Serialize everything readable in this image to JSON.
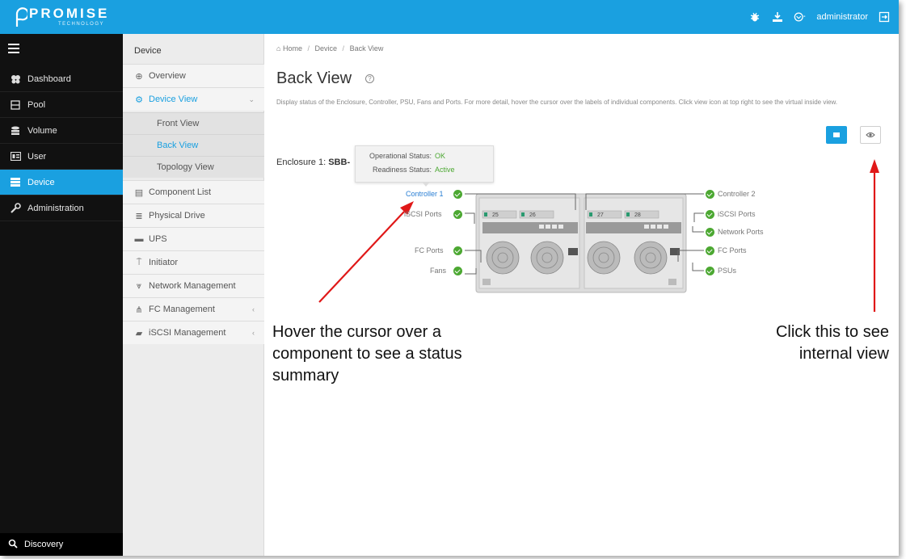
{
  "brand": {
    "name": "PROMISE",
    "sub": "TECHNOLOGY"
  },
  "topbar": {
    "user": "administrator",
    "icons": [
      "bug-icon",
      "download-icon",
      "user-status-icon",
      "logout-icon"
    ]
  },
  "sidebar": {
    "items": [
      {
        "label": "Dashboard",
        "icon": "dashboard-icon"
      },
      {
        "label": "Pool",
        "icon": "pool-icon"
      },
      {
        "label": "Volume",
        "icon": "volume-icon"
      },
      {
        "label": "User",
        "icon": "user-icon"
      },
      {
        "label": "Device",
        "icon": "device-icon",
        "active": true
      },
      {
        "label": "Administration",
        "icon": "wrench-icon"
      }
    ],
    "discovery": "Discovery"
  },
  "submenu": {
    "header": "Device",
    "items": [
      {
        "label": "Overview"
      },
      {
        "label": "Device View"
      },
      {
        "label": "Front View"
      },
      {
        "label": "Back View"
      },
      {
        "label": "Topology View"
      },
      {
        "label": "Component List"
      },
      {
        "label": "Physical Drive"
      },
      {
        "label": "UPS"
      },
      {
        "label": "Initiator"
      },
      {
        "label": "Network Management"
      },
      {
        "label": "FC Management"
      },
      {
        "label": "iSCSI Management"
      }
    ]
  },
  "breadcrumb": {
    "home": "Home",
    "device": "Device",
    "current": "Back View"
  },
  "page": {
    "title": "Back View",
    "description": "Display status of the Enclosure, Controller, PSU, Fans and Ports. For more detail, hover the cursor over the labels of individual components. Click view icon at top right to see the virtual inside view.",
    "enclosure_prefix": "Enclosure 1:",
    "enclosure_name": "SBB-"
  },
  "tooltip": {
    "status_label": "Operational Status:",
    "status_value": "OK",
    "readiness_label": "Readiness Status:",
    "readiness_value": "Active"
  },
  "components_left": [
    "Controller 1",
    "iSCSI Ports",
    "FC Ports",
    "Fans"
  ],
  "components_right": [
    "Controller 2",
    "iSCSI Ports",
    "Network Ports",
    "FC Ports",
    "PSUs"
  ],
  "device_port_labels": [
    "25",
    "26",
    "27",
    "28"
  ],
  "callouts": {
    "left": [
      "Hover the cursor over a",
      "component to see a status",
      "summary"
    ],
    "right": [
      "Click this to see",
      "internal view"
    ]
  },
  "colors": {
    "accent": "#1aa0e0",
    "ok": "#4ca832",
    "arrow": "#e01818",
    "sidebar": "#111111"
  }
}
